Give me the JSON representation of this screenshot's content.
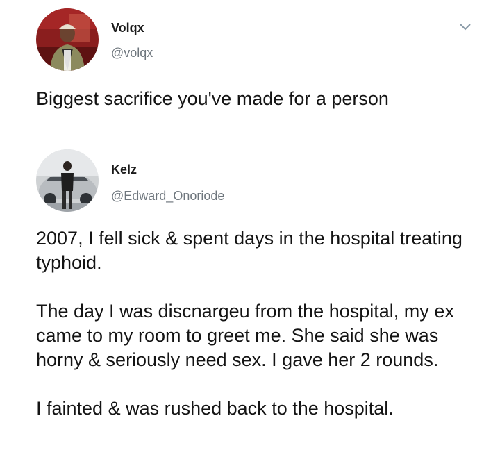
{
  "tweets": [
    {
      "author": {
        "name": "Volqx",
        "handle": "@volqx"
      },
      "menu_icon": "chevron-down-icon",
      "text": "Biggest sacrifice you've made for a person"
    },
    {
      "author": {
        "name": "Kelz",
        "handle": "@Edward_Onoriode"
      },
      "paragraphs": [
        "2007, I fell sick & spent days in the hospital treating typhoid.",
        "The day I was discnargeu from the hospital, my ex came to my room to greet me. She said she was horny & seriously need sex. I gave her 2 rounds.",
        "I fainted & was rushed back to the hospital."
      ]
    }
  ],
  "colors": {
    "text": "#141414",
    "handle": "#6e767d",
    "background": "#ffffff"
  }
}
